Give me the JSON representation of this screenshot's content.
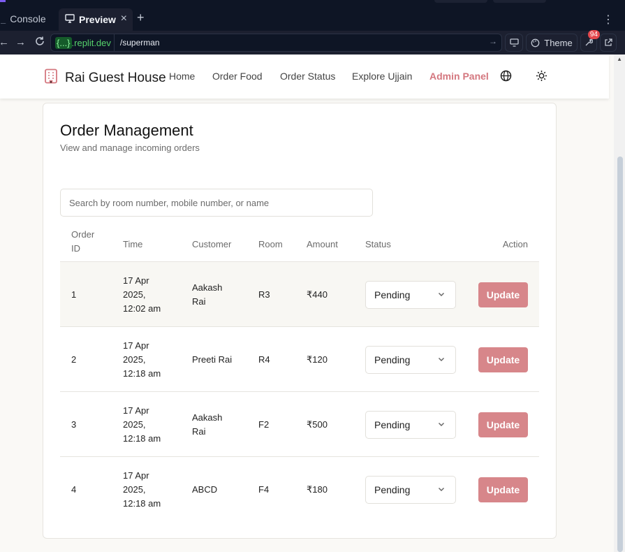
{
  "ide": {
    "tabs": [
      {
        "label": "Console",
        "active": false
      },
      {
        "label": "Preview",
        "active": true
      }
    ],
    "url": {
      "host_prefix": "{...}",
      "host_suffix": ".replit.dev",
      "path": "/superman"
    },
    "theme_label": "Theme",
    "notification_count": "94",
    "colors": {
      "background": "#0e1525",
      "panel": "#1c2030",
      "host_green": "#56d36c"
    }
  },
  "site": {
    "brand": "Rai Guest House",
    "nav": [
      {
        "label": "Home",
        "active": false
      },
      {
        "label": "Order Food",
        "active": false
      },
      {
        "label": "Order Status",
        "active": false
      },
      {
        "label": "Explore Ujjain",
        "active": false
      },
      {
        "label": "Admin Panel",
        "active": true
      }
    ],
    "accent_color": "#d4777f"
  },
  "orders": {
    "title": "Order Management",
    "subtitle": "View and manage incoming orders",
    "search_placeholder": "Search by room number, mobile number, or name",
    "columns": {
      "order_id_line1": "Order",
      "order_id_line2": "ID",
      "time": "Time",
      "customer": "Customer",
      "room": "Room",
      "amount": "Amount",
      "status": "Status",
      "action": "Action"
    },
    "rows": [
      {
        "id": "1",
        "time": [
          "17 Apr",
          "2025,",
          "12:02 am"
        ],
        "customer": [
          "Aakash",
          "Rai"
        ],
        "room": "R3",
        "amount": "₹440",
        "status": "Pending",
        "action": "Update"
      },
      {
        "id": "2",
        "time": [
          "17 Apr",
          "2025,",
          "12:18 am"
        ],
        "customer": [
          "Preeti Rai"
        ],
        "room": "R4",
        "amount": "₹120",
        "status": "Pending",
        "action": "Update"
      },
      {
        "id": "3",
        "time": [
          "17 Apr",
          "2025,",
          "12:18 am"
        ],
        "customer": [
          "Aakash",
          "Rai"
        ],
        "room": "F2",
        "amount": "₹500",
        "status": "Pending",
        "action": "Update"
      },
      {
        "id": "4",
        "time": [
          "17 Apr",
          "2025,",
          "12:18 am"
        ],
        "customer": [
          "ABCD"
        ],
        "room": "F4",
        "amount": "₹180",
        "status": "Pending",
        "action": "Update"
      }
    ],
    "button_color": "#d7868a"
  }
}
